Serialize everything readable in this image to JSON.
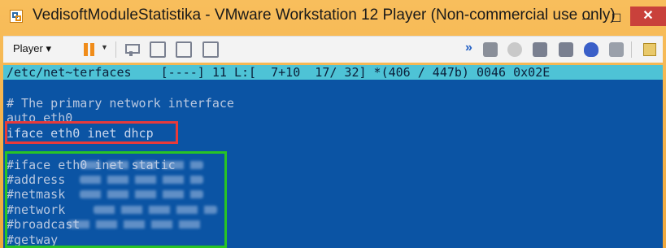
{
  "window": {
    "title": "VedisoftModuleStatistika - VMware Workstation 12 Player (Non-commercial use only)",
    "close_glyph": "✕",
    "min_glyph": "—",
    "max_glyph": "☐"
  },
  "toolbar": {
    "player_label": "Player ▾",
    "pause_caret": "▼",
    "chevron": "»",
    "icons": [
      "pause-icon",
      "devices-icon",
      "fit-guest-icon",
      "fullscreen-icon",
      "unity-icon",
      "network-icon",
      "cd-icon",
      "printer-icon",
      "sound-icon",
      "display-icon",
      "message-icon"
    ]
  },
  "terminal": {
    "status": "/etc/net~terfaces    [----] 11 L:[  7+10  17/ 32] *(406 / 447b) 0046 0x02E",
    "lines": [
      "# The primary network interface",
      "auto eth0",
      "iface eth0 inet dhcp",
      "#iface eth0 inet static",
      "#address",
      "#netmask",
      "#network",
      "#broadcast",
      "#getway"
    ]
  },
  "colors": {
    "terminal_bg": "#0b54a4",
    "status_bg": "#4ec3d6",
    "highlight_red": "#e83a3a",
    "highlight_green": "#28c424",
    "window_frame": "#f6b24a"
  }
}
